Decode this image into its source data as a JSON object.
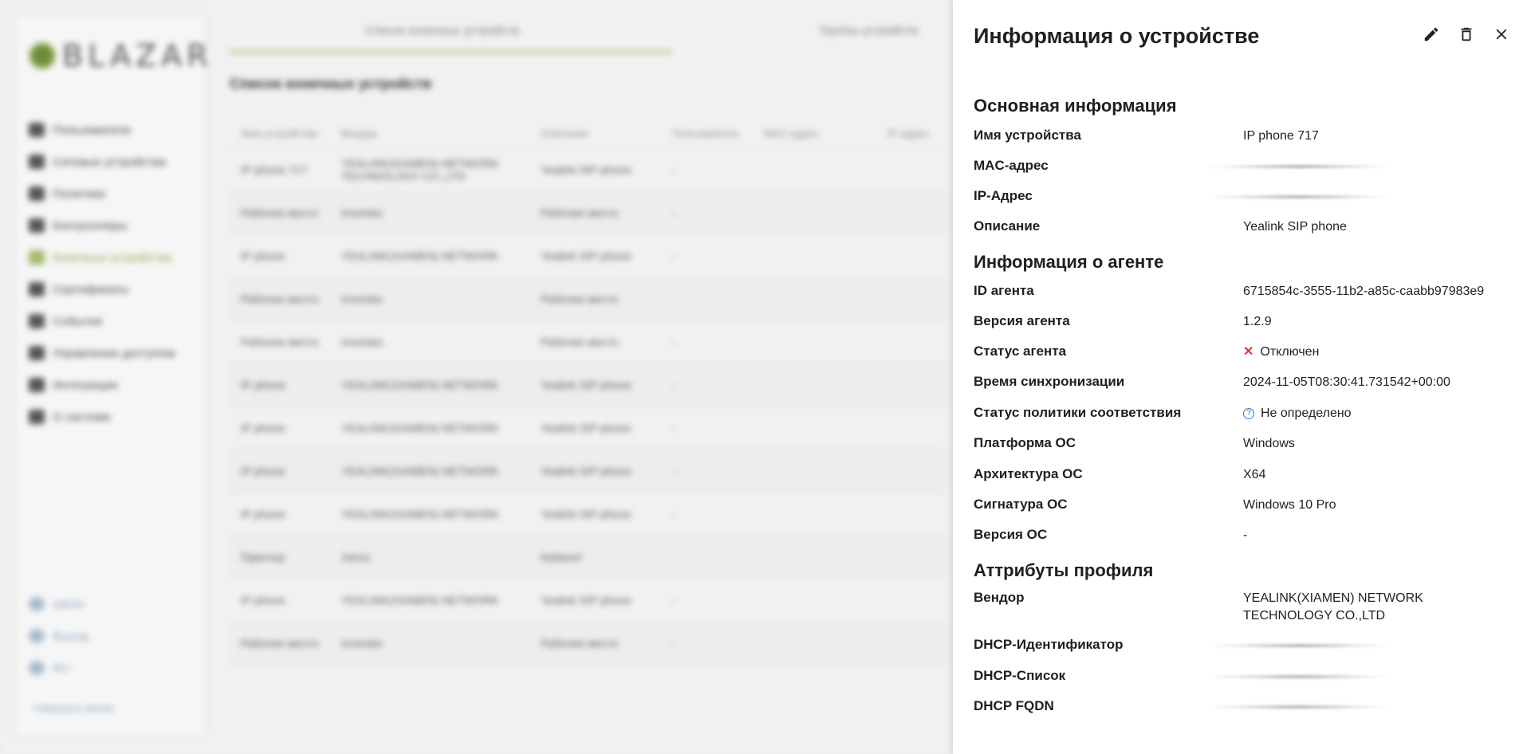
{
  "background": {
    "logo_text": "BLAZAR",
    "nav": [
      "Пользователи",
      "Сетевые устройства",
      "Политики",
      "Контроллеры",
      "Конечные устройства",
      "Сертификаты",
      "События",
      "Управление доступом",
      "Интеграции",
      "О системе"
    ],
    "nav_active_index": 4,
    "bottom_nav": [
      "admin",
      "Выход",
      "RU"
    ],
    "collapse_label": "Свернуть меню",
    "tabs": [
      "Список конечных устройств",
      "Группы устройств"
    ],
    "section_title": "Список конечных устройств",
    "columns": [
      "Имя устройства",
      "Вендор",
      "Описание",
      "Пользователь",
      "MAC-адрес",
      "IP-адрес"
    ],
    "rows": [
      [
        "IP phone 717",
        "YEALINK(XIAMEN) NETWORK TECHNOLOGY CO.,LTD",
        "Yealink SIP phone",
        "-",
        "",
        ""
      ],
      [
        "Рабочее место",
        "Inventec",
        "Рабочее место",
        "-",
        "",
        ""
      ],
      [
        "IP phone",
        "YEALINK(XIAMEN) NETWORK",
        "Yealink SIP phone",
        "-",
        "",
        ""
      ],
      [
        "Рабочее место",
        "Inventec",
        "Рабочее место",
        "",
        "",
        ""
      ],
      [
        "Рабочее место",
        "Inventec",
        "Рабочее место",
        "-",
        "",
        ""
      ],
      [
        "IP phone",
        "YEALINK(XIAMEN) NETWORK",
        "Yealink SIP phone",
        "-",
        "",
        ""
      ],
      [
        "IP phone",
        "YEALINK(XIAMEN) NETWORK",
        "Yealink SIP phone",
        "-",
        "",
        ""
      ],
      [
        "IP phone",
        "YEALINK(XIAMEN) NETWORK",
        "Yealink SIP phone",
        "-",
        "",
        ""
      ],
      [
        "IP phone",
        "YEALINK(XIAMEN) NETWORK",
        "Yealink SIP phone",
        "-",
        "",
        ""
      ],
      [
        "Принтер",
        "Xerox",
        "Кабинет",
        "",
        "",
        ""
      ],
      [
        "IP phone",
        "YEALINK(XIAMEN) NETWORK",
        "Yealink SIP phone",
        "-",
        "",
        ""
      ],
      [
        "Рабочее место",
        "Inventec",
        "Рабочее место",
        "-",
        "",
        ""
      ]
    ]
  },
  "panel": {
    "title": "Информация о устройстве",
    "actions": {
      "edit_icon": "pencil-icon",
      "delete_icon": "trash-icon",
      "close_icon": "close-icon"
    },
    "sections": {
      "basic": {
        "heading": "Основная информация",
        "fields": {
          "device_name": {
            "label": "Имя устройства",
            "value": "IP phone 717"
          },
          "mac": {
            "label": "MAC-адрес",
            "value": ""
          },
          "ip": {
            "label": "IP-Адрес",
            "value": ""
          },
          "description": {
            "label": "Описание",
            "value": "Yealink SIP phone"
          }
        }
      },
      "agent": {
        "heading": "Информация о агенте",
        "fields": {
          "agent_id": {
            "label": "ID агента",
            "value": "6715854c-3555-11b2-a85c-caabb97983e9"
          },
          "agent_version": {
            "label": "Версия агента",
            "value": "1.2.9"
          },
          "agent_status": {
            "label": "Статус агента",
            "value": "Отключен",
            "color": "#e53935"
          },
          "sync_time": {
            "label": "Время синхронизации",
            "value": "2024-11-05T08:30:41.731542+00:00"
          },
          "compliance": {
            "label": "Статус политики соответствия",
            "value": "Не определено",
            "color": "#2f7fc9"
          },
          "os_platform": {
            "label": "Платформа ОС",
            "value": "Windows"
          },
          "os_arch": {
            "label": "Архитектура ОС",
            "value": "X64"
          },
          "os_signature": {
            "label": "Сигнатура ОС",
            "value": "Windows 10 Pro"
          },
          "os_version": {
            "label": "Версия ОС",
            "value": "-"
          }
        }
      },
      "profile": {
        "heading": "Аттрибуты профиля",
        "fields": {
          "vendor": {
            "label": "Вендор",
            "value": "YEALINK(XIAMEN) NETWORK TECHNOLOGY CO.,LTD"
          },
          "dhcp_id": {
            "label": "DHCP-Идентификатор",
            "value": ""
          },
          "dhcp_list": {
            "label": "DHCP-Список",
            "value": ""
          },
          "dhcp_fqdn": {
            "label": "DHCP FQDN",
            "value": ""
          }
        }
      }
    }
  }
}
